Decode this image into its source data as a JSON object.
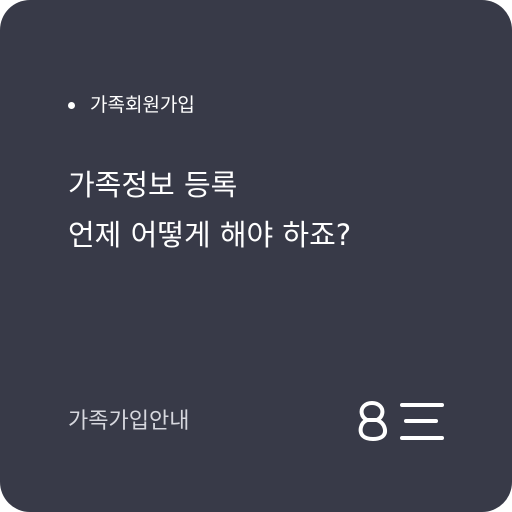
{
  "card": {
    "category": "가족회원가입",
    "headline": {
      "line1": "가족정보 등록",
      "line2": "언제 어떻게 해야 하죠?"
    },
    "footer_label": "가족가입안내",
    "logo_icon": "brand-logo-icon",
    "background_color": "#383a48",
    "text_color": "#ffffff"
  }
}
